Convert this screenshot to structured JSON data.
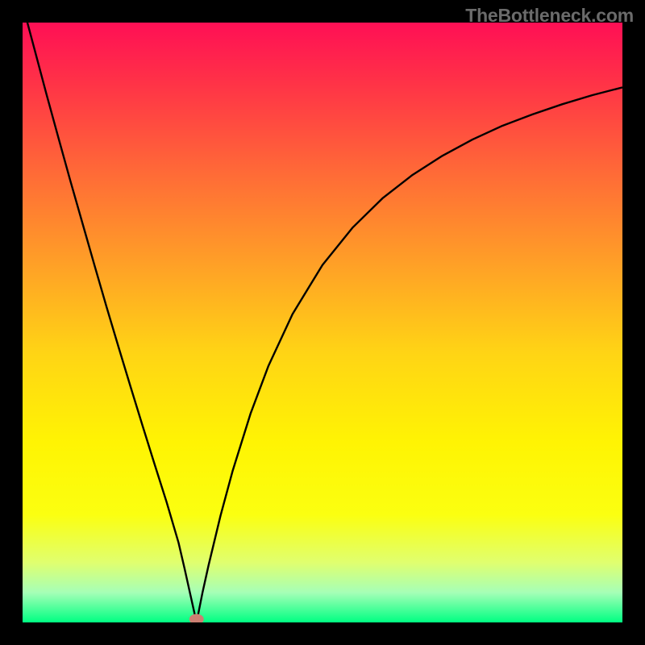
{
  "watermark": "TheBottleneck.com",
  "chart_data": {
    "type": "line",
    "title": "",
    "xlabel": "",
    "ylabel": "",
    "xlim": [
      0,
      100
    ],
    "ylim": [
      0,
      100
    ],
    "minimum_x": 29,
    "left_branch_x": [
      0,
      2,
      4,
      6,
      8,
      10,
      12,
      14,
      16,
      18,
      20,
      22,
      24,
      26,
      27,
      28,
      29
    ],
    "left_branch_y": [
      103,
      95.5,
      88,
      80.7,
      73.5,
      66.5,
      59.5,
      52.6,
      45.9,
      39.3,
      32.8,
      26.4,
      20.1,
      13.3,
      9.0,
      4.5,
      0.0
    ],
    "right_branch_x": [
      29,
      30,
      31,
      33,
      35,
      38,
      41,
      45,
      50,
      55,
      60,
      65,
      70,
      75,
      80,
      85,
      90,
      95,
      100
    ],
    "right_branch_y": [
      0.0,
      5.0,
      9.5,
      17.8,
      25.2,
      34.8,
      42.8,
      51.4,
      59.6,
      65.8,
      70.7,
      74.6,
      77.8,
      80.5,
      82.8,
      84.7,
      86.4,
      87.9,
      89.2
    ],
    "marker": {
      "x": 29,
      "y": 0,
      "color": "#cc7f72"
    },
    "gradient_stops": [
      {
        "offset": 0.0,
        "color": "#ff0f55"
      },
      {
        "offset": 0.1,
        "color": "#ff3247"
      },
      {
        "offset": 0.25,
        "color": "#ff6a37"
      },
      {
        "offset": 0.4,
        "color": "#ff9f27"
      },
      {
        "offset": 0.55,
        "color": "#ffd415"
      },
      {
        "offset": 0.7,
        "color": "#fff403"
      },
      {
        "offset": 0.82,
        "color": "#fbff10"
      },
      {
        "offset": 0.9,
        "color": "#e0ff6f"
      },
      {
        "offset": 0.95,
        "color": "#a6ffb7"
      },
      {
        "offset": 1.0,
        "color": "#00ff82"
      }
    ]
  }
}
